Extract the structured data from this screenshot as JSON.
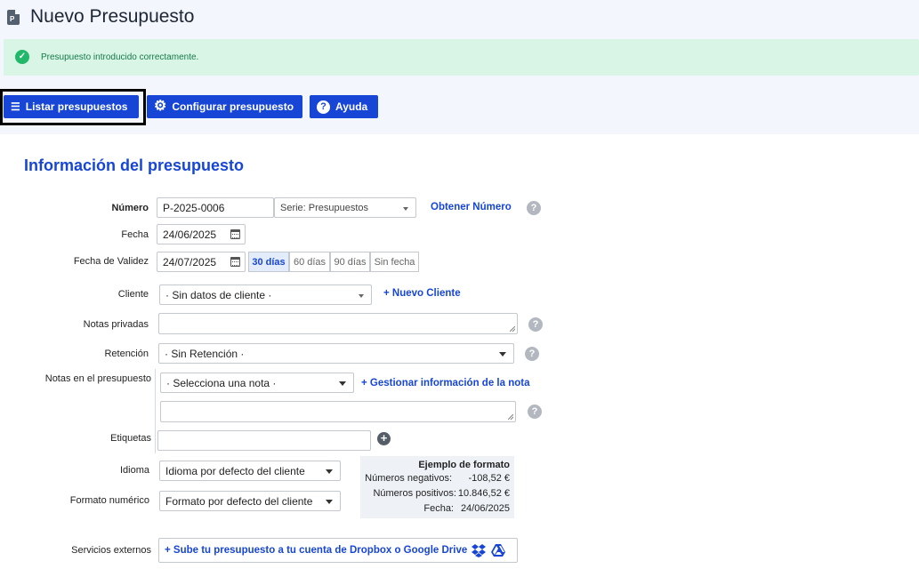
{
  "page": {
    "title": "Nuevo Presupuesto",
    "icon": "document-p-icon"
  },
  "alert": {
    "text": "Presupuesto introducido correctamente.",
    "icon": "check-circle-icon",
    "color": "#22b86a"
  },
  "toolbar": {
    "list_label": "Listar presupuestos",
    "config_label": "Configurar presupuesto",
    "help_label": "Ayuda",
    "accent": "#1746d6"
  },
  "section": {
    "title": "Información del presupuesto"
  },
  "form": {
    "numero": {
      "label": "Número",
      "value": "P-2025-0006",
      "serie": "Serie: Presupuestos",
      "obtain_link": "Obtener Número"
    },
    "fecha": {
      "label": "Fecha",
      "value": "24/06/2025"
    },
    "validez": {
      "label": "Fecha de Validez",
      "value": "24/07/2025",
      "options": [
        "30 días",
        "60 días",
        "90 días",
        "Sin fecha"
      ],
      "selected": "30 días"
    },
    "cliente": {
      "label": "Cliente",
      "value": "· Sin datos de cliente ·",
      "new_link": "+ Nuevo Cliente"
    },
    "notas_privadas": {
      "label": "Notas privadas",
      "value": ""
    },
    "retencion": {
      "label": "Retención",
      "value": "· Sin Retención ·"
    },
    "notas_presupuesto": {
      "label": "Notas en el presupuesto",
      "select_value": "· Selecciona una nota ·",
      "manage_link": "+ Gestionar información de la nota",
      "value": ""
    },
    "etiquetas": {
      "label": "Etiquetas",
      "value": ""
    },
    "idioma": {
      "label": "Idioma",
      "value": "Idioma por defecto del cliente"
    },
    "formato": {
      "label": "Formato numérico",
      "value": "Formato por defecto del cliente"
    },
    "servicios": {
      "label": "Servicios externos",
      "upload_text": "+ Sube tu presupuesto a tu cuenta de Dropbox o Google Drive"
    }
  },
  "format_example": {
    "title": "Ejemplo de formato",
    "negative_label": "Números negativos:",
    "negative_value": "-108,52 €",
    "positive_label": "Números positivos:",
    "positive_value": "10.846,52 €",
    "date_label": "Fecha:",
    "date_value": "24/06/2025"
  }
}
